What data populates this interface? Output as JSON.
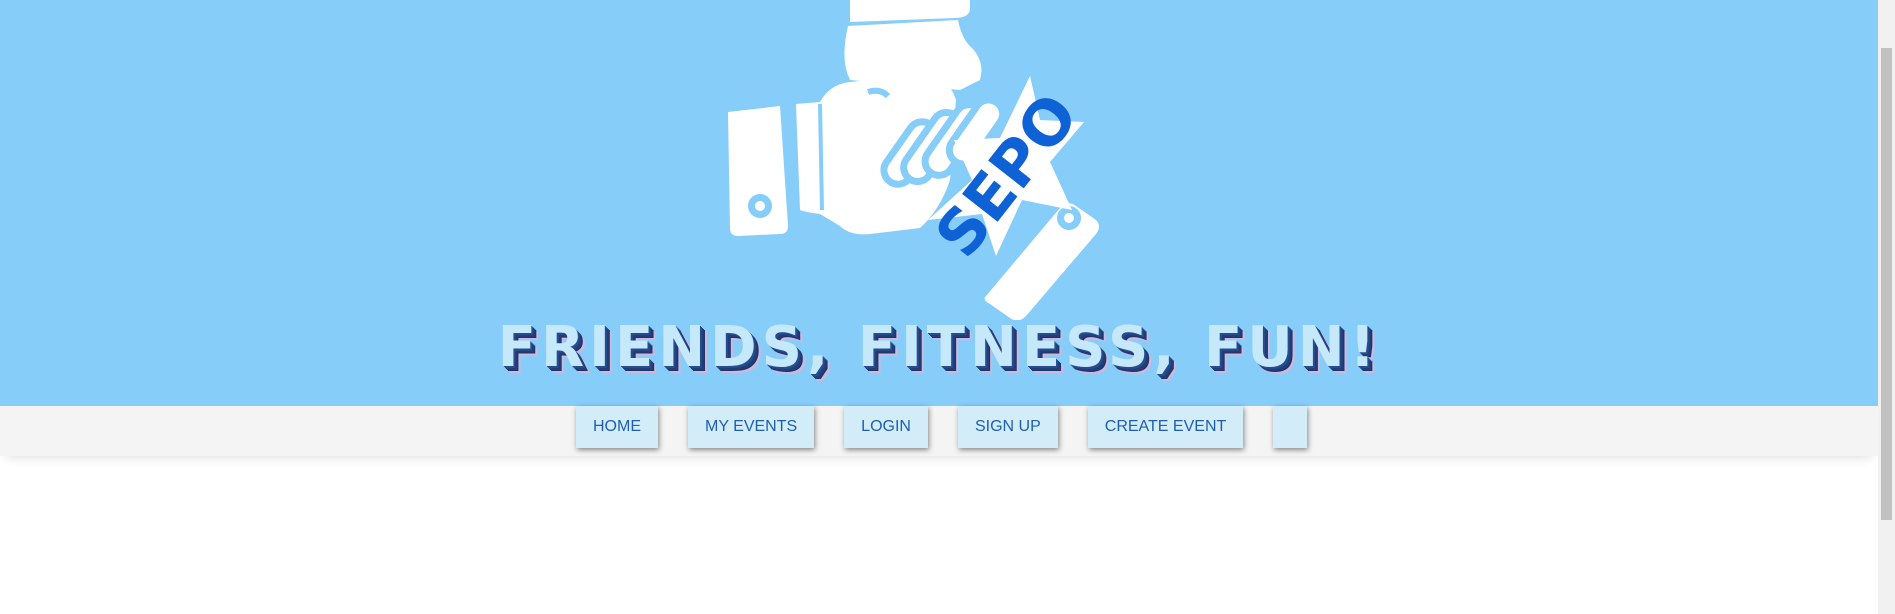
{
  "hero": {
    "logo_text": "SEPO",
    "tagline": "FRIENDS, FITNESS, FUN!",
    "background_color": "#87cdfa",
    "logo_text_color": "#0f62d6"
  },
  "nav": {
    "items": [
      {
        "label": "HOME"
      },
      {
        "label": "MY EVENTS"
      },
      {
        "label": "LOGIN"
      },
      {
        "label": "SIGN UP"
      },
      {
        "label": "CREATE EVENT"
      },
      {
        "label": ""
      }
    ],
    "button_color": "#d2ecf8",
    "text_color": "#1f5fb3"
  }
}
